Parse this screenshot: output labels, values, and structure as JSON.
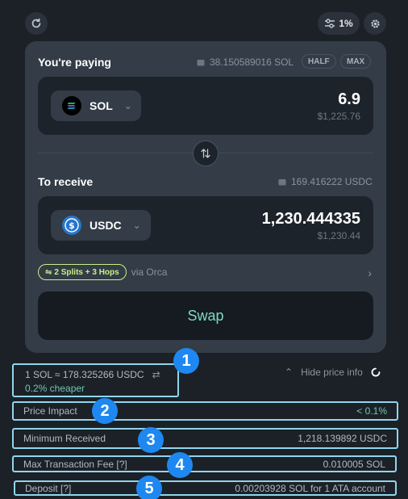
{
  "header": {
    "slippage": "1%"
  },
  "paying": {
    "label": "You're paying",
    "balance": "38.150589016 SOL",
    "half": "HALF",
    "max": "MAX",
    "token": "SOL",
    "amount": "6.9",
    "usd": "$1,225.76"
  },
  "receive": {
    "label": "To receive",
    "balance": "169.416222 USDC",
    "token": "USDC",
    "amount": "1,230.444335",
    "usd": "$1,230.44"
  },
  "route": {
    "badge": "2 Splits + 3 Hops",
    "via": "via Orca"
  },
  "swap_label": "Swap",
  "price_info": {
    "rate": "1 SOL ≈ 178.325266 USDC",
    "cheaper": "0.2% cheaper",
    "toggle": "Hide price info",
    "rows": [
      {
        "label": "Price Impact",
        "value": "< 0.1%"
      },
      {
        "label": "Minimum Received",
        "value": "1,218.139892 USDC"
      },
      {
        "label": "Max Transaction Fee [?]",
        "value": "0.010005 SOL"
      },
      {
        "label": "Deposit [?]",
        "value": "0.00203928 SOL for 1 ATA account"
      }
    ]
  },
  "badges": [
    "1",
    "2",
    "3",
    "4",
    "5"
  ],
  "colors": {
    "accent": "#7ddac2",
    "route": "#c8f284",
    "highlight": "#8fd6ec",
    "badge": "#1e88f0"
  }
}
